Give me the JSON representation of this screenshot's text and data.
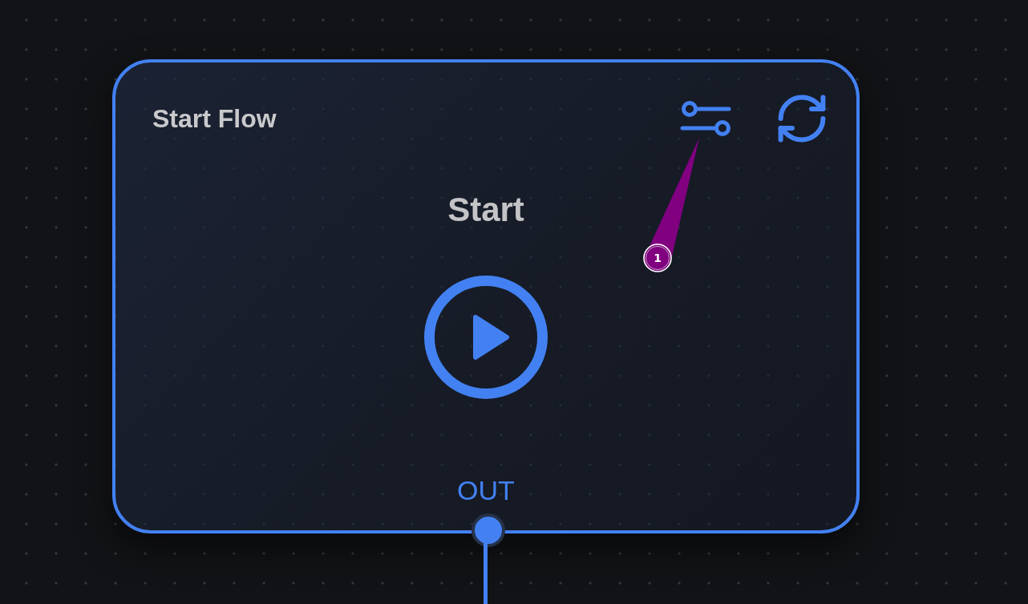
{
  "node": {
    "title": "Start Flow",
    "heading": "Start",
    "output_port": {
      "label": "OUT"
    }
  },
  "callout": {
    "label": "1"
  }
}
